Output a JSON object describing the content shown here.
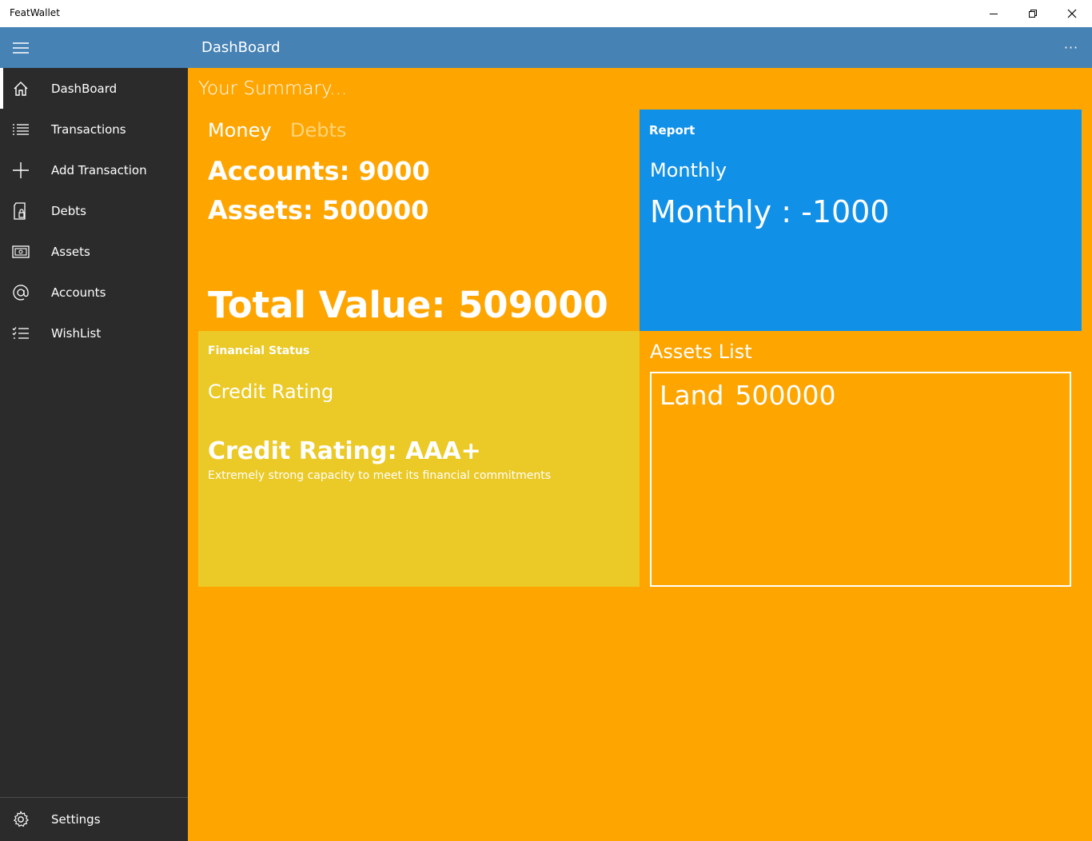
{
  "window": {
    "app_title": "FeatWallet",
    "controls": [
      "minimize-icon",
      "restore-icon",
      "close-icon"
    ]
  },
  "header": {
    "page_title": "DashBoard",
    "menu_icon": "hamburger-icon",
    "more_label": "···"
  },
  "sidebar": {
    "items": [
      {
        "label": "DashBoard",
        "icon": "home-icon",
        "active": true
      },
      {
        "label": "Transactions",
        "icon": "list-icon"
      },
      {
        "label": "Add Transaction",
        "icon": "plus-icon"
      },
      {
        "label": "Debts",
        "icon": "debts-icon"
      },
      {
        "label": "Assets",
        "icon": "assets-icon"
      },
      {
        "label": "Accounts",
        "icon": "at-icon"
      },
      {
        "label": "WishList",
        "icon": "checklist-icon"
      }
    ],
    "settings": {
      "label": "Settings",
      "icon": "gear-icon"
    }
  },
  "main": {
    "summary_title": "Your Summary...",
    "tabs": {
      "money": "Money",
      "debts": "Debts"
    },
    "accounts": "Accounts: 9000",
    "assets": "Assets: 500000",
    "total": "Total Value: 509000",
    "report": {
      "header": "Report",
      "period": "Monthly",
      "value": "Monthly : -1000"
    },
    "financial_status": {
      "header": "Financial Status",
      "subtitle": "Credit Rating",
      "rating": "Credit Rating: AAA+",
      "description": "Extremely strong capacity to meet its financial commitments"
    },
    "assets_list": {
      "title": "Assets List",
      "items": [
        {
          "name": "Land",
          "amount": "500000"
        }
      ]
    }
  },
  "colors": {
    "header": "#4682b4",
    "sidebar": "#2b2b2b",
    "main": "#ffa500",
    "report": "#1190e8",
    "financial_status": "#ebc926"
  }
}
